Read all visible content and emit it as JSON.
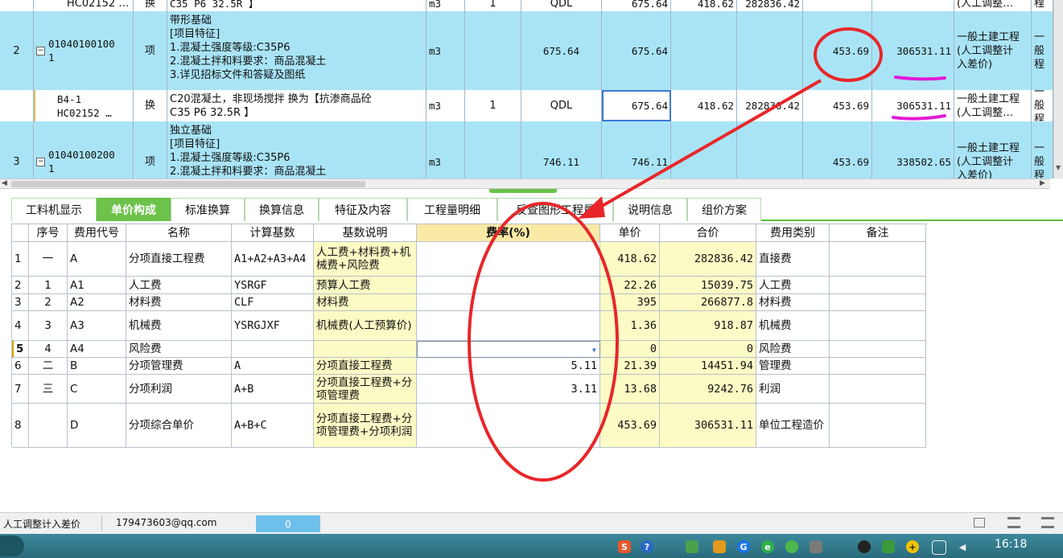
{
  "upper_grid": {
    "rows": [
      {
        "no": "",
        "code": "HC02152 …",
        "type": "换",
        "name": "C35 P6 32.5R 】",
        "unit": "m3",
        "qty": "1",
        "qdl": "QDL",
        "v1": "675.64",
        "v2": "418.62",
        "v3": "282836.42",
        "v4": "",
        "v5": "",
        "cat": "(人工调整…",
        "last": "程"
      },
      {
        "no": "2",
        "code": "01040100100\n1",
        "type": "项",
        "name": "带形基础\n[项目特征]\n1.混凝土强度等级:C35P6\n2.混凝土拌和料要求：商品混凝土\n3.详见招标文件和答疑及图纸",
        "unit": "m3",
        "qty": "",
        "qdl": "675.64",
        "v1": "675.64",
        "v2": "",
        "v3": "",
        "v4": "453.69",
        "v5": "306531.11",
        "cat": "一般土建工程\n(人工调整计\n入差价)",
        "last": "一般\n程"
      },
      {
        "no": "",
        "code": "B4-1\nHC02152 …",
        "type": "换",
        "name": "C20混凝土，非现场搅拌  换为【抗渗商品砼\nC35 P6 32.5R 】",
        "unit": "m3",
        "qty": "1",
        "qdl": "QDL",
        "v1": "675.64",
        "v2": "418.62",
        "v3": "282836.42",
        "v4": "453.69",
        "v5": "306531.11",
        "cat": "一般土建工程\n(人工调整…",
        "last": "一般\n程"
      },
      {
        "no": "3",
        "code": "01040100200\n1",
        "type": "项",
        "name": "独立基础\n[项目特征]\n1.混凝土强度等级:C35P6\n2.混凝土拌和料要求：商品混凝土",
        "unit": "m3",
        "qty": "",
        "qdl": "746.11",
        "v1": "746.11",
        "v2": "",
        "v3": "",
        "v4": "453.69",
        "v5": "338502.65",
        "cat": "一般土建工程\n(人工调整计\n入差价)",
        "last": "一般\n程"
      }
    ]
  },
  "tabs": [
    "工料机显示",
    "单价构成",
    "标准换算",
    "换算信息",
    "特征及内容",
    "工程量明细",
    "反查图形工程量",
    "说明信息",
    "组价方案"
  ],
  "active_tab": "单价构成",
  "lower_grid": {
    "headers": [
      "序号",
      "费用代号",
      "名称",
      "计算基数",
      "基数说明",
      "费率(%)",
      "单价",
      "合价",
      "费用类别",
      "备注"
    ],
    "rows": [
      {
        "idx": "1",
        "seq": "一",
        "code": "A",
        "name": "分项直接工程费",
        "base": "A1+A2+A3+A4",
        "desc": "人工费+材料费+机械费+风险费",
        "rate": "",
        "price": "418.62",
        "total": "282836.42",
        "cat": "直接费",
        "note": ""
      },
      {
        "idx": "2",
        "seq": "1",
        "code": "A1",
        "name": "人工费",
        "base": "YSRGF",
        "desc": "预算人工费",
        "rate": "",
        "price": "22.26",
        "total": "15039.75",
        "cat": "人工费",
        "note": ""
      },
      {
        "idx": "3",
        "seq": "2",
        "code": "A2",
        "name": "材料费",
        "base": "CLF",
        "desc": "材料费",
        "rate": "",
        "price": "395",
        "total": "266877.8",
        "cat": "材料费",
        "note": ""
      },
      {
        "idx": "4",
        "seq": "3",
        "code": "A3",
        "name": "机械费",
        "base": "YSRGJXF",
        "desc": "机械费(人工预算价)",
        "rate": "",
        "price": "1.36",
        "total": "918.87",
        "cat": "机械费",
        "note": ""
      },
      {
        "idx": "5",
        "seq": "4",
        "code": "A4",
        "name": "风险费",
        "base": "",
        "desc": "",
        "rate": "",
        "price": "0",
        "total": "0",
        "cat": "风险费",
        "note": ""
      },
      {
        "idx": "6",
        "seq": "二",
        "code": "B",
        "name": "分项管理费",
        "base": "A",
        "desc": "分项直接工程费",
        "rate": "5.11",
        "price": "21.39",
        "total": "14451.94",
        "cat": "管理费",
        "note": ""
      },
      {
        "idx": "7",
        "seq": "三",
        "code": "C",
        "name": "分项利润",
        "base": "A+B",
        "desc": "分项直接工程费+分项管理费",
        "rate": "3.11",
        "price": "13.68",
        "total": "9242.76",
        "cat": "利润",
        "note": ""
      },
      {
        "idx": "8",
        "seq": "",
        "code": "D",
        "name": "分项综合单价",
        "base": "A+B+C",
        "desc": "分项直接工程费+分项管理费+分项利润",
        "rate": "",
        "price": "453.69",
        "total": "306531.11",
        "cat": "单位工程造价",
        "note": ""
      }
    ]
  },
  "status": {
    "left": "人工调整计入差价",
    "email": "179473603@qq.com",
    "counter": "0"
  },
  "clock": "16:18",
  "colors": {
    "row_blue": "#a9e4f6",
    "yellow": "#fdfbc5",
    "tab_green": "#6cc24a",
    "annotation_red": "#e8262a",
    "annotation_magenta": "#e21bd8"
  }
}
